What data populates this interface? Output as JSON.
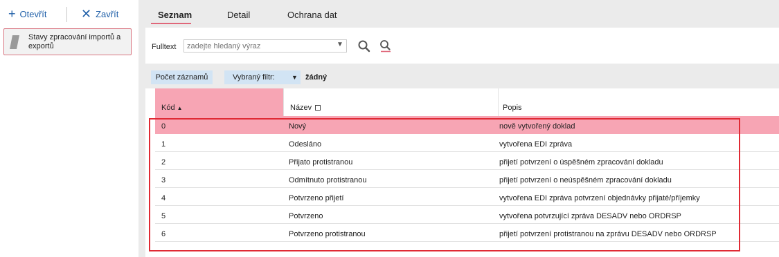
{
  "toolbar": {
    "open_label": "Otevřít",
    "close_label": "Zavřít"
  },
  "sidebar": {
    "items": [
      {
        "label": "Stavy zpracování importů a exportů"
      }
    ]
  },
  "tabs": [
    {
      "label": "Seznam"
    },
    {
      "label": "Detail"
    },
    {
      "label": "Ochrana dat"
    }
  ],
  "fulltext": {
    "label": "Fulltext",
    "placeholder": "zadejte hledaný výraz"
  },
  "filter": {
    "count_label": "Počet záznamů",
    "selected_label": "Vybraný filtr:",
    "selected_value": "žádný"
  },
  "table": {
    "columns": [
      "Kód",
      "Název",
      "Popis"
    ],
    "rows": [
      {
        "kod": "0",
        "nazev": "Nový",
        "popis": "nově vytvořený doklad"
      },
      {
        "kod": "1",
        "nazev": "Odesláno",
        "popis": "vytvořena EDI zpráva"
      },
      {
        "kod": "2",
        "nazev": "Přijato protistranou",
        "popis": "přijetí potvrzení o úspěšném zpracování dokladu"
      },
      {
        "kod": "3",
        "nazev": "Odmítnuto protistranou",
        "popis": "přijetí potvrzení o neúspěšném zpracování dokladu"
      },
      {
        "kod": "4",
        "nazev": "Potvrzeno přijetí",
        "popis": "vytvořena EDI zpráva potvrzení objednávky přijaté/příjemky"
      },
      {
        "kod": "5",
        "nazev": "Potvrzeno",
        "popis": "vytvořena potvrzující zpráva DESADV nebo ORDRSP"
      },
      {
        "kod": "6",
        "nazev": "Potvrzeno protistranou",
        "popis": "přijetí potvrzení protistranou na zprávu DESADV nebo ORDRSP"
      }
    ]
  },
  "colors": {
    "accent": "#e0677a",
    "selected_row": "#f7a5b4",
    "link_blue": "#1f5fa8",
    "annotation_red": "#e02a34"
  }
}
